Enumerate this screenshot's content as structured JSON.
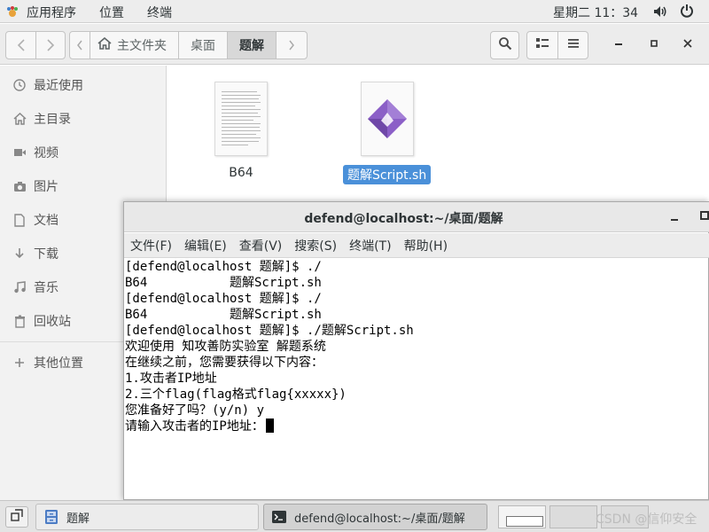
{
  "top_bar": {
    "apps_menu": "应用程序",
    "places_menu": "位置",
    "terminal_menu": "终端",
    "clock": "星期二 11：34"
  },
  "file_manager": {
    "path": {
      "home": "主文件夹",
      "desktop": "桌面",
      "current": "题解"
    },
    "sidebar": {
      "items": [
        {
          "label": "最近使用",
          "icon": "clock-icon"
        },
        {
          "label": "主目录",
          "icon": "home-icon"
        },
        {
          "label": "视频",
          "icon": "video-icon"
        },
        {
          "label": "图片",
          "icon": "camera-icon"
        },
        {
          "label": "文档",
          "icon": "document-icon"
        },
        {
          "label": "下载",
          "icon": "download-icon"
        },
        {
          "label": "音乐",
          "icon": "music-icon"
        },
        {
          "label": "回收站",
          "icon": "trash-icon"
        },
        {
          "label": "其他位置",
          "icon": "plus-icon"
        }
      ]
    },
    "files": [
      {
        "name": "B64",
        "type": "text-document",
        "selected": false
      },
      {
        "name": "题解Script.sh",
        "type": "shell-script",
        "selected": true
      }
    ]
  },
  "terminal": {
    "title": "defend@localhost:~/桌面/题解",
    "menu": [
      "文件(F)",
      "编辑(E)",
      "查看(V)",
      "搜索(S)",
      "终端(T)",
      "帮助(H)"
    ],
    "lines": [
      "[defend@localhost 题解]$ ./",
      "B64           题解Script.sh",
      "[defend@localhost 题解]$ ./",
      "B64           题解Script.sh",
      "[defend@localhost 题解]$ ./题解Script.sh",
      "欢迎使用 知攻善防实验室 解题系统",
      "在继续之前，您需要获得以下内容：",
      "1.攻击者IP地址",
      "2.三个flag(flag格式flag{xxxxx})",
      "您准备好了吗？(y/n) y",
      "请输入攻击者的IP地址："
    ]
  },
  "taskbar": {
    "files_task": "题解",
    "terminal_task": "defend@localhost:~/桌面/题解",
    "watermark": "CSDN @信仰安全"
  }
}
